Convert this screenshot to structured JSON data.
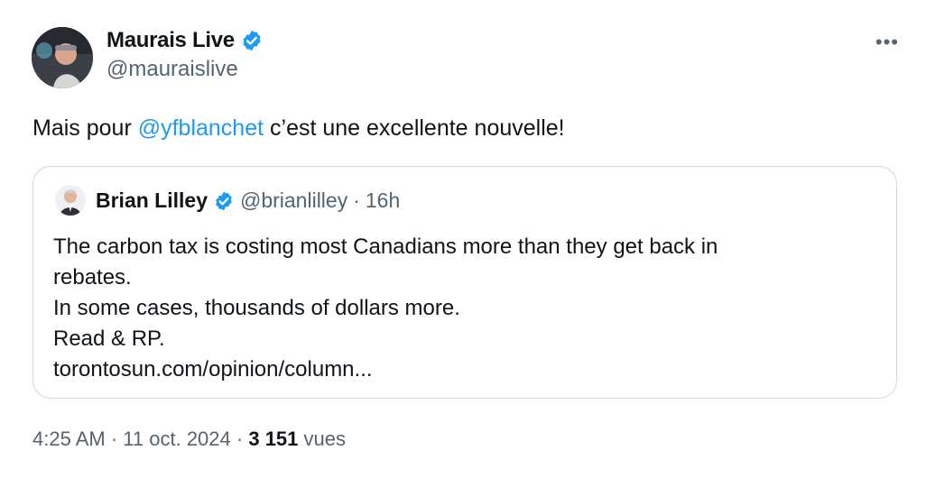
{
  "tweet": {
    "author": {
      "name": "Maurais Live",
      "handle": "@mauraislive"
    },
    "more_label": "•••",
    "text_pre": "Mais pour ",
    "mention": "@yfblanchet",
    "text_post": " c’est une excellente nouvelle!"
  },
  "quote": {
    "author": {
      "name": "Brian Lilley",
      "handle": "@brianlilley",
      "separator": "·",
      "time": "16h"
    },
    "lines": [
      "The carbon tax is costing most Canadians more than they get back in",
      "rebates.",
      "In some cases, thousands of dollars more.",
      "Read & RP.",
      "torontosun.com/opinion/column..."
    ]
  },
  "footer": {
    "time": "4:25 AM",
    "sep1": "·",
    "date": "11 oct. 2024",
    "sep2": "·",
    "views_count": "3 151",
    "views_label": "vues"
  },
  "colors": {
    "accent": "#1d9bf0",
    "secondary_text": "#536471",
    "border": "#cfd9de"
  },
  "icons": {
    "verified": "verified-badge-icon",
    "more": "more-options-icon"
  }
}
